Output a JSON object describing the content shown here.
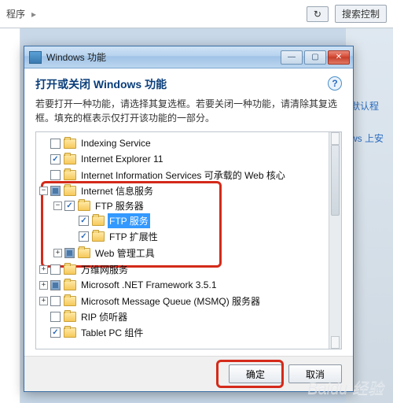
{
  "bg": {
    "crumb1": "程序",
    "refresh": "↻",
    "search_btn": "搜索控制",
    "side1": "默认程",
    "side2": "ws 上安"
  },
  "dialog": {
    "window_title": "Windows 功能",
    "min": "—",
    "max": "▢",
    "close": "✕",
    "heading": "打开或关闭 Windows 功能",
    "help": "?",
    "description": "若要打开一种功能，请选择其复选框。若要关闭一种功能，请清除其复选框。填充的框表示仅打开该功能的一部分。"
  },
  "tree": {
    "n0": {
      "label": "Indexing Service",
      "expander": "",
      "check": "none"
    },
    "n1": {
      "label": "Internet Explorer 11",
      "expander": "",
      "check": "checked"
    },
    "n2": {
      "label": "Internet Information Services 可承载的 Web 核心",
      "expander": "",
      "check": "none"
    },
    "n3": {
      "label": "Internet 信息服务",
      "expander": "−",
      "check": "filled"
    },
    "n3_0": {
      "label": "FTP 服务器",
      "expander": "−",
      "check": "checked"
    },
    "n3_0_0": {
      "label": "FTP 服务",
      "expander": "",
      "check": "checked",
      "selected": true
    },
    "n3_0_1": {
      "label": "FTP 扩展性",
      "expander": "",
      "check": "checked"
    },
    "n3_1": {
      "label": "Web 管理工具",
      "expander": "+",
      "check": "filled"
    },
    "n4": {
      "label": "万维网服务",
      "expander": "+",
      "check": "none"
    },
    "n5": {
      "label": "Microsoft .NET Framework 3.5.1",
      "expander": "+",
      "check": "filled"
    },
    "n6": {
      "label": "Microsoft Message Queue (MSMQ) 服务器",
      "expander": "+",
      "check": "none"
    },
    "n7": {
      "label": "RIP 侦听器",
      "expander": "",
      "check": "none"
    },
    "n8": {
      "label": "Tablet PC 组件",
      "expander": "",
      "check": "checked"
    }
  },
  "buttons": {
    "ok": "确定",
    "cancel": "取消"
  },
  "watermark": "Baidu 经验"
}
